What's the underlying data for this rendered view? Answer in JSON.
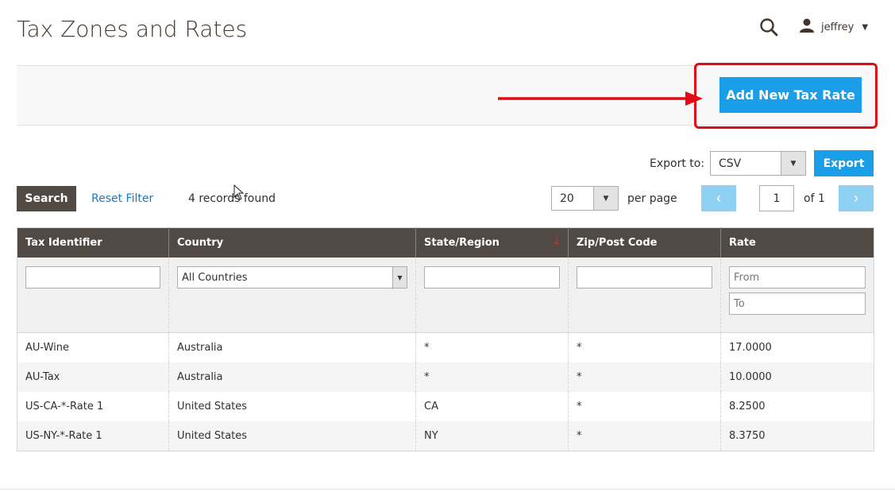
{
  "header": {
    "title": "Tax Zones and Rates",
    "username": "jeffrey"
  },
  "page_actions": {
    "add_button_label": "Add New Tax Rate",
    "highlight_color": "#e10b17"
  },
  "export": {
    "label": "Export to:",
    "selected": "CSV",
    "button_label": "Export"
  },
  "toolbar": {
    "search_label": "Search",
    "reset_label": "Reset Filter",
    "records_found": "4 records found",
    "per_page_value": "20",
    "per_page_label": "per page",
    "current_page": "1",
    "page_total": "of 1"
  },
  "grid": {
    "columns": [
      "Tax Identifier",
      "Country",
      "State/Region",
      "Zip/Post Code",
      "Rate"
    ],
    "sorted_column": "State/Region",
    "filters": {
      "country_selected": "All Countries",
      "rate_from_placeholder": "From",
      "rate_to_placeholder": "To"
    },
    "rows": [
      [
        "AU-Wine",
        "Australia",
        "*",
        "*",
        "17.0000"
      ],
      [
        "AU-Tax",
        "Australia",
        "*",
        "*",
        "10.0000"
      ],
      [
        "US-CA-*-Rate 1",
        "United States",
        "CA",
        "*",
        "8.2500"
      ],
      [
        "US-NY-*-Rate 1",
        "United States",
        "NY",
        "*",
        "8.3750"
      ]
    ]
  },
  "colors": {
    "primary_button": "#1a9ee8",
    "header_bg": "#514943",
    "link": "#1979c3"
  }
}
